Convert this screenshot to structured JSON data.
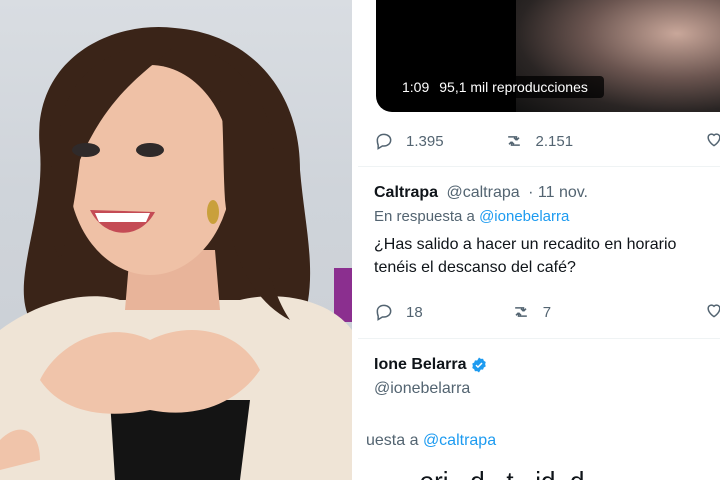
{
  "video": {
    "duration": "1:09",
    "views": "95,1 mil reproducciones"
  },
  "tweet_actions": {
    "replies": "1.395",
    "retweets": "2.151"
  },
  "reply_tweet": {
    "name": "Caltrapa",
    "handle": "@caltrapa",
    "date": "· 11 nov.",
    "reply_prefix": "En respuesta a",
    "reply_to": "@ionebelarra",
    "text_line1": "¿Has salido a hacer un recadito en horario",
    "text_line2": "tenéis el descanso del café?",
    "replies": "18",
    "retweets": "7"
  },
  "author_tweet": {
    "name": "Ione Belarra",
    "handle": "@ionebelarra",
    "reply_prefix": "uesta a",
    "reply_to": "@caltrapa",
    "partial_text": "...eri...d...t...id..d..."
  },
  "colors": {
    "link": "#1d9bf0",
    "muted": "#536471",
    "verified": "#1d9bf0"
  },
  "icons": [
    "reply-icon",
    "retweet-icon",
    "heart-icon",
    "verified-badge-icon"
  ]
}
